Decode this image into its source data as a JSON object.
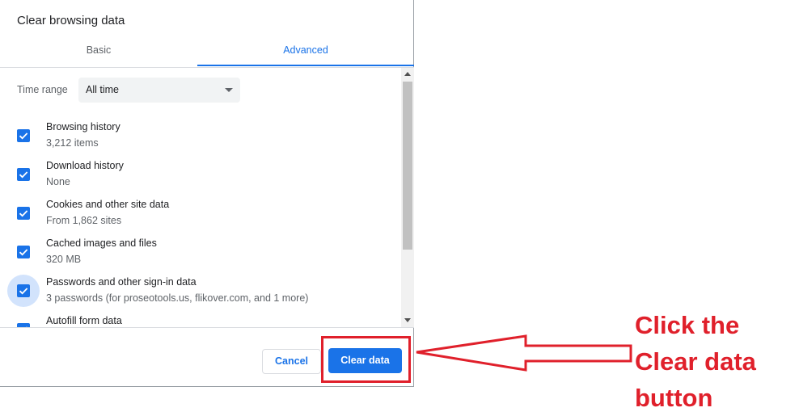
{
  "dialog": {
    "title": "Clear browsing data",
    "tabs": [
      {
        "label": "Basic"
      },
      {
        "label": "Advanced"
      }
    ],
    "time_range": {
      "label": "Time range",
      "selected": "All time"
    },
    "options": [
      {
        "label": "Browsing history",
        "sub": "3,212 items",
        "checked": true
      },
      {
        "label": "Download history",
        "sub": "None",
        "checked": true
      },
      {
        "label": "Cookies and other site data",
        "sub": "From 1,862 sites",
        "checked": true
      },
      {
        "label": "Cached images and files",
        "sub": "320 MB",
        "checked": true
      },
      {
        "label": "Passwords and other sign-in data",
        "sub": "3 passwords (for proseotools.us, flikover.com, and 1 more)",
        "checked": true
      },
      {
        "label": "Autofill form data",
        "sub": "",
        "checked": true
      }
    ],
    "buttons": {
      "cancel": "Cancel",
      "clear": "Clear data"
    }
  },
  "annotation": {
    "lines": [
      "Click the",
      "Clear data",
      "button"
    ],
    "color": "#e0202b"
  },
  "colors": {
    "accent": "#1a73e8"
  }
}
